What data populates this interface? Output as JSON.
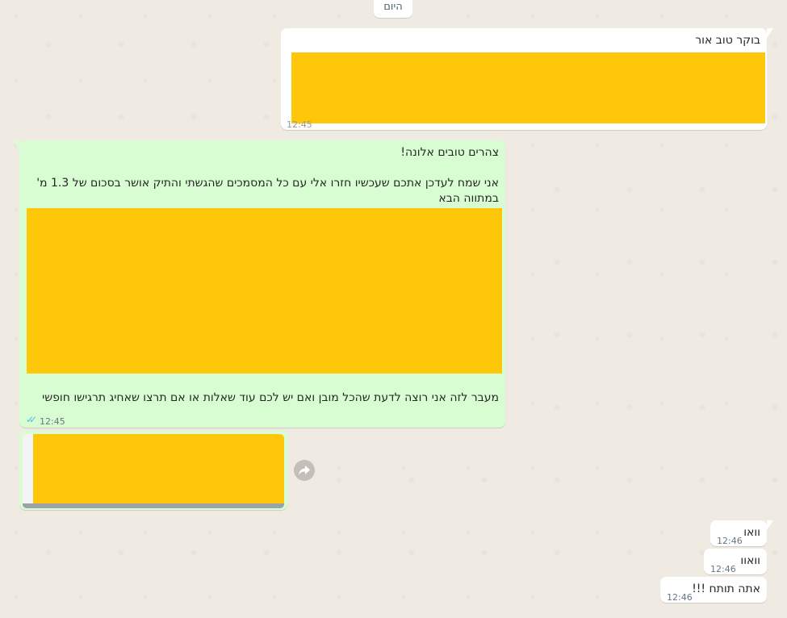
{
  "chat": {
    "date_chip": "היום",
    "messages": [
      {
        "id": "m1",
        "direction": "incoming",
        "text_lines": [
          "בוקר טוב אור"
        ],
        "time": "12:45",
        "redacted": true
      },
      {
        "id": "m2",
        "direction": "outgoing",
        "text_lines": [
          "צהרים טובים אלונה!",
          "אני שמח לעדכן אתכם שעכשיו חזרו אלי עם כל המסמכים שהגשתי והתיק אושר בסכום של 1.3 מ'",
          "במתווה הבא",
          "מעבר לזה אני רוצה לדעת שהכל מובן ואם יש לכם עוד שאלות או אם תרצו שאחיג תרגישו חופשי"
        ],
        "time": "12:45",
        "status": "read",
        "redacted": true
      },
      {
        "id": "m3",
        "direction": "outgoing",
        "type": "document",
        "redacted": true
      },
      {
        "id": "m4",
        "direction": "incoming",
        "text": "וואו",
        "time": "12:46"
      },
      {
        "id": "m5",
        "direction": "incoming",
        "text": "וואוו",
        "time": "12:46"
      },
      {
        "id": "m6",
        "direction": "incoming",
        "text": "אתה תותח !!!",
        "time": "12:46"
      }
    ]
  },
  "colors": {
    "incoming_bubble": "#ffffff",
    "outgoing_bubble": "#d9fdd3",
    "read_ticks": "#53bdeb",
    "redaction": "#ffc709"
  }
}
